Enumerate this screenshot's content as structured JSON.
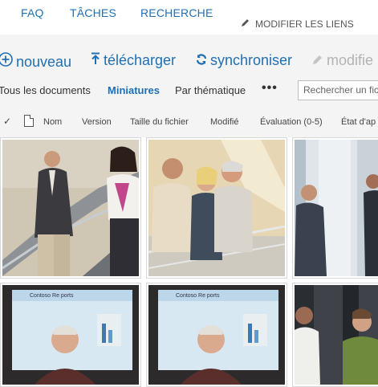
{
  "topnav": {
    "links": [
      "FAQ",
      "TÂCHES",
      "RECHERCHE"
    ],
    "edit_links": "MODIFIER LES LIENS"
  },
  "toolbar": {
    "new_label": "nouveau",
    "upload_label": "télécharger",
    "sync_label": "synchroniser",
    "edit_label": "modifie"
  },
  "views": {
    "all_docs": "Tous les documents",
    "thumbnails": "Miniatures",
    "by_topic": "Par thématique",
    "more": "•••"
  },
  "search": {
    "placeholder": "Rechercher un fich"
  },
  "columns": [
    "Nom",
    "Version",
    "Taille du fichier",
    "Modifié",
    "Évaluation (0-5)",
    "État d'ap"
  ],
  "thumbnails": {
    "slide_text": "Contoso Re  ports"
  },
  "colors": {
    "accent": "#1f6fb5",
    "band": "#f4f4f4"
  }
}
